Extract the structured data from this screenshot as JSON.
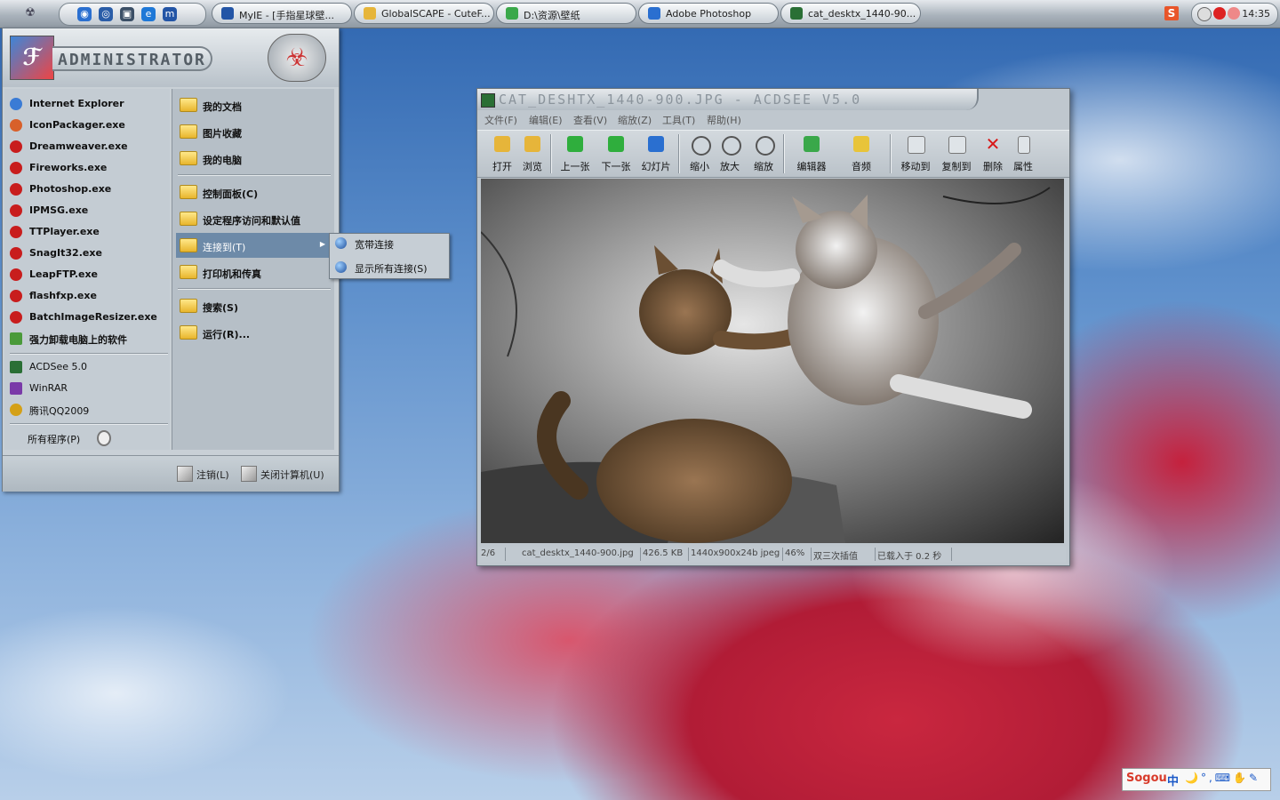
{
  "taskbar": {
    "windows": [
      {
        "label": "MyIE - [手指星球壁..."
      },
      {
        "label": "GlobalSCAPE - CuteF..."
      },
      {
        "label": "D:\\资源\\壁纸"
      },
      {
        "label": "Adobe Photoshop"
      },
      {
        "label": "cat_desktx_1440-90..."
      }
    ],
    "clock": "14:35"
  },
  "start_menu": {
    "user": "ADMINISTRATOR",
    "pinned": [
      {
        "label": "Internet Explorer",
        "color": "#3a7bd5"
      },
      {
        "label": "IconPackager.exe",
        "color": "#d8602a"
      },
      {
        "label": "Dreamweaver.exe",
        "color": "#c81d1d"
      },
      {
        "label": "Fireworks.exe",
        "color": "#c81d1d"
      },
      {
        "label": "Photoshop.exe",
        "color": "#c81d1d"
      },
      {
        "label": "IPMSG.exe",
        "color": "#c81d1d"
      },
      {
        "label": "TTPlayer.exe",
        "color": "#c81d1d"
      },
      {
        "label": "SnagIt32.exe",
        "color": "#c81d1d"
      },
      {
        "label": "LeapFTP.exe",
        "color": "#c81d1d"
      },
      {
        "label": "flashfxp.exe",
        "color": "#c81d1d"
      },
      {
        "label": "BatchImageResizer.exe",
        "color": "#c81d1d"
      },
      {
        "label": "强力卸载电脑上的软件",
        "color": "#4a9a3a"
      }
    ],
    "recent": [
      {
        "label": "ACDSee 5.0",
        "color": "#2a6f35"
      },
      {
        "label": "WinRAR",
        "color": "#7a3aa8"
      },
      {
        "label": "腾讯QQ2009",
        "color": "#d4a017"
      }
    ],
    "all_programs": "所有程序(P)",
    "right": [
      {
        "label": "我的文档"
      },
      {
        "label": "图片收藏"
      },
      {
        "label": "我的电脑"
      },
      {
        "label": "控制面板(C)"
      },
      {
        "label": "设定程序访问和默认值"
      },
      {
        "label": "连接到(T)"
      },
      {
        "label": "打印机和传真"
      },
      {
        "label": "搜索(S)"
      },
      {
        "label": "运行(R)..."
      }
    ],
    "logoff": "注销(L)",
    "shutdown": "关闭计算机(U)",
    "submenu": [
      {
        "label": "宽带连接"
      },
      {
        "label": "显示所有连接(S)"
      }
    ]
  },
  "acdsee": {
    "title": "CAT_DESHTX_1440-900.JPG - ACDSEE V5.0",
    "menu": [
      "文件(F)",
      "编辑(E)",
      "查看(V)",
      "缩放(Z)",
      "工具(T)",
      "帮助(H)"
    ],
    "toolbar": [
      {
        "label": "打开",
        "color": "#e6b53a"
      },
      {
        "label": "浏览",
        "color": "#e6b53a"
      },
      {
        "label": "上一张",
        "color": "#2fae3d"
      },
      {
        "label": "下一张",
        "color": "#2fae3d"
      },
      {
        "label": "幻灯片",
        "color": "#2a6fd0"
      },
      {
        "label": "缩小",
        "color": "#cfd6dc"
      },
      {
        "label": "放大",
        "color": "#cfd6dc"
      },
      {
        "label": "缩放",
        "color": "#cfd6dc"
      },
      {
        "label": "编辑器",
        "color": "#3aa84a"
      },
      {
        "label": "音频",
        "color": "#e8c43a"
      },
      {
        "label": "移动到",
        "color": "#dfe4e8"
      },
      {
        "label": "复制到",
        "color": "#dfe4e8"
      },
      {
        "label": "删除",
        "color": "#d81818"
      },
      {
        "label": "属性",
        "color": "#dfe4e8"
      }
    ],
    "status": [
      "2/6",
      "cat_desktx_1440-900.jpg",
      "426.5 KB",
      "1440x900x24b jpeg",
      "46%",
      "双三次插值",
      "已载入于 0.2 秒"
    ]
  },
  "ime": {
    "brand": "Sogou",
    "mode": "中",
    "tools": "🌙°,⌨✋✎"
  }
}
